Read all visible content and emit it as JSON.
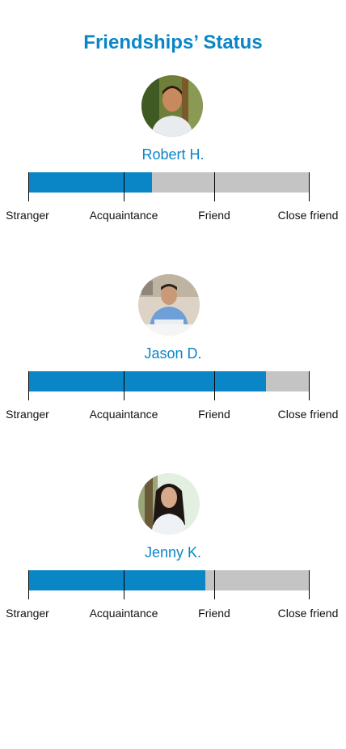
{
  "page_title": "Friendships’ Status",
  "stages": [
    "Stranger",
    "Acquaintance",
    "Friend",
    "Close friend"
  ],
  "friends": [
    {
      "name": "Robert H.",
      "progress": 0.44,
      "avatar": "avatar-robert-photo"
    },
    {
      "name": "Jason D.",
      "progress": 0.847,
      "avatar": "avatar-jason-photo"
    },
    {
      "name": "Jenny K.",
      "progress": 0.631,
      "avatar": "avatar-jenny-photo"
    }
  ],
  "colors": {
    "accent": "#0a86c6",
    "track": "#c4c4c4",
    "tick": "#000000"
  }
}
